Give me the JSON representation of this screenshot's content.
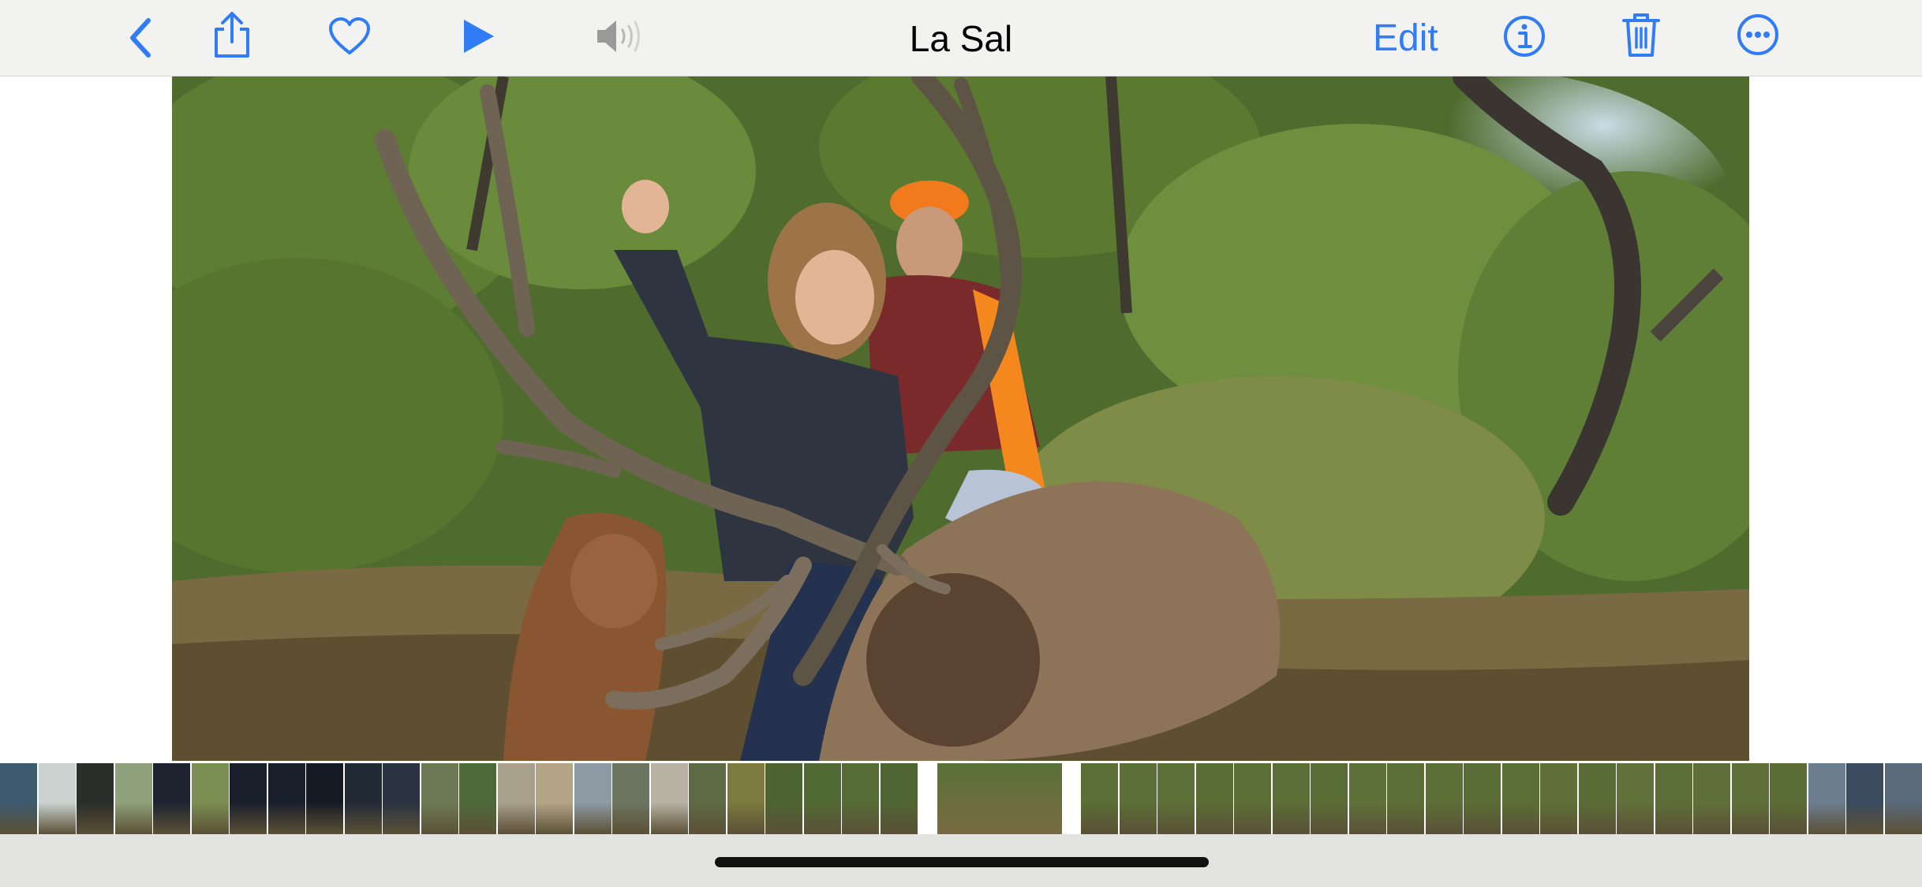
{
  "toolbar": {
    "title": "La Sal",
    "edit_label": "Edit",
    "accent_color": "#2f7cf6",
    "disabled_color": "#9a9a9a",
    "buttons": {
      "back": "chevron-left-icon",
      "share": "share-icon",
      "favorite": "heart-icon",
      "play": "play-icon",
      "sound": "speaker-muted-icon",
      "info": "info-icon",
      "delete": "trash-icon",
      "more": "ellipsis-icon"
    }
  },
  "photo": {
    "subject": "elk-hunt-photo"
  },
  "filmstrip": {
    "thumb_colors": [
      "#3d5a6e",
      "#c9d2cf",
      "#2a2d2a",
      "#8fa07c",
      "#1d2430",
      "#7c8f52",
      "#1a1f2c",
      "#1a1f2c",
      "#151a24",
      "#222a36",
      "#2a3342",
      "#6d7a55",
      "#4e6a3a",
      "#a8a08a",
      "#b5a587",
      "#8e9aa4",
      "#6c7560",
      "#b8b3a5",
      "#5e6a43",
      "#7c7a3e",
      "#4d6432",
      "#516a35",
      "#566c36",
      "#4f6534",
      "#587238",
      "#5a6e35",
      "#5b6f36",
      "#5d7038",
      "#5a6d35",
      "#5c6f37",
      "#5b6e36",
      "#5a6d35",
      "#5e7139",
      "#5b6e37",
      "#5c6f37",
      "#5a6d36",
      "#5b6e36",
      "#5f7038",
      "#5a6c35",
      "#61713a",
      "#5c6e38",
      "#60703a",
      "#5e6f39",
      "#5b6d36",
      "#6c7d8e",
      "#3b4a5e",
      "#5a6a7a",
      "#465a74",
      "#3e4b5c",
      "#2e3a4a"
    ]
  }
}
